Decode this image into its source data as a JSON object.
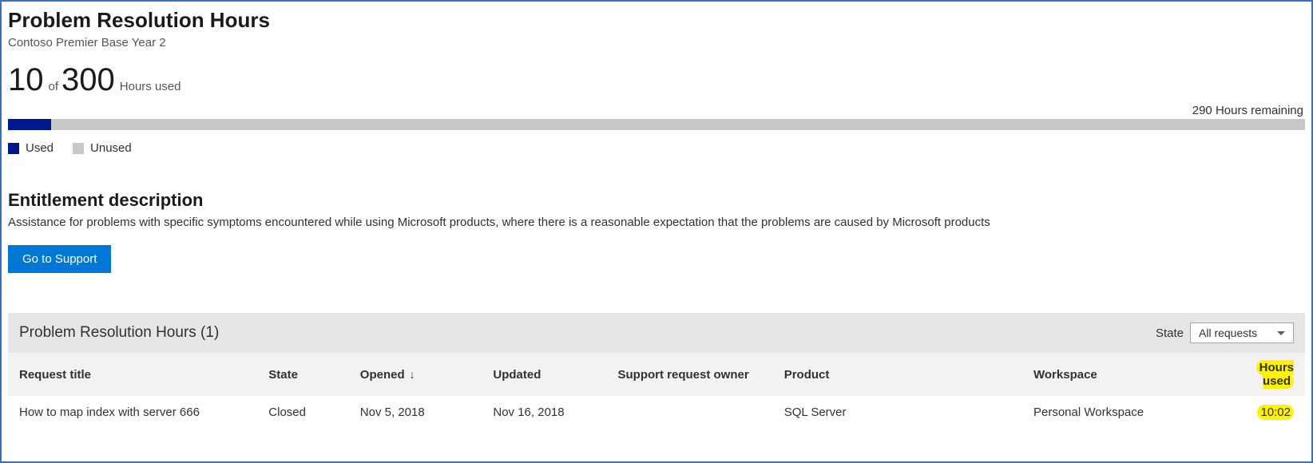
{
  "header": {
    "title": "Problem Resolution Hours",
    "subtitle": "Contoso Premier Base Year 2"
  },
  "usage": {
    "used": "10",
    "of_label": "of",
    "total": "300",
    "suffix": "Hours used",
    "remaining": "290 Hours remaining",
    "progress_percent": 3.33,
    "legend": {
      "used_label": "Used",
      "unused_label": "Unused"
    }
  },
  "entitlement": {
    "heading": "Entitlement description",
    "text": "Assistance for problems with specific symptoms encountered while using Microsoft products, where there is a reasonable expectation that the problems are caused by Microsoft products",
    "button": "Go to Support"
  },
  "requests": {
    "panel_title": "Problem Resolution Hours (1)",
    "state_label": "State",
    "state_value": "All requests",
    "columns": {
      "title": "Request title",
      "state": "State",
      "opened": "Opened",
      "updated": "Updated",
      "owner": "Support request owner",
      "product": "Product",
      "workspace": "Workspace",
      "hours": "Hours used"
    },
    "sort_indicator": "↓",
    "rows": [
      {
        "title": "How to map index with server 666",
        "state": "Closed",
        "opened": "Nov 5, 2018",
        "updated": "Nov 16, 2018",
        "owner": "",
        "product": "SQL Server",
        "workspace": "Personal Workspace",
        "hours": "10:02"
      }
    ]
  },
  "chart_data": {
    "type": "bar",
    "title": "Problem Resolution Hours usage",
    "categories": [
      "Used",
      "Unused"
    ],
    "values": [
      10,
      290
    ],
    "ylim": [
      0,
      300
    ],
    "xlabel": "",
    "ylabel": "Hours"
  }
}
